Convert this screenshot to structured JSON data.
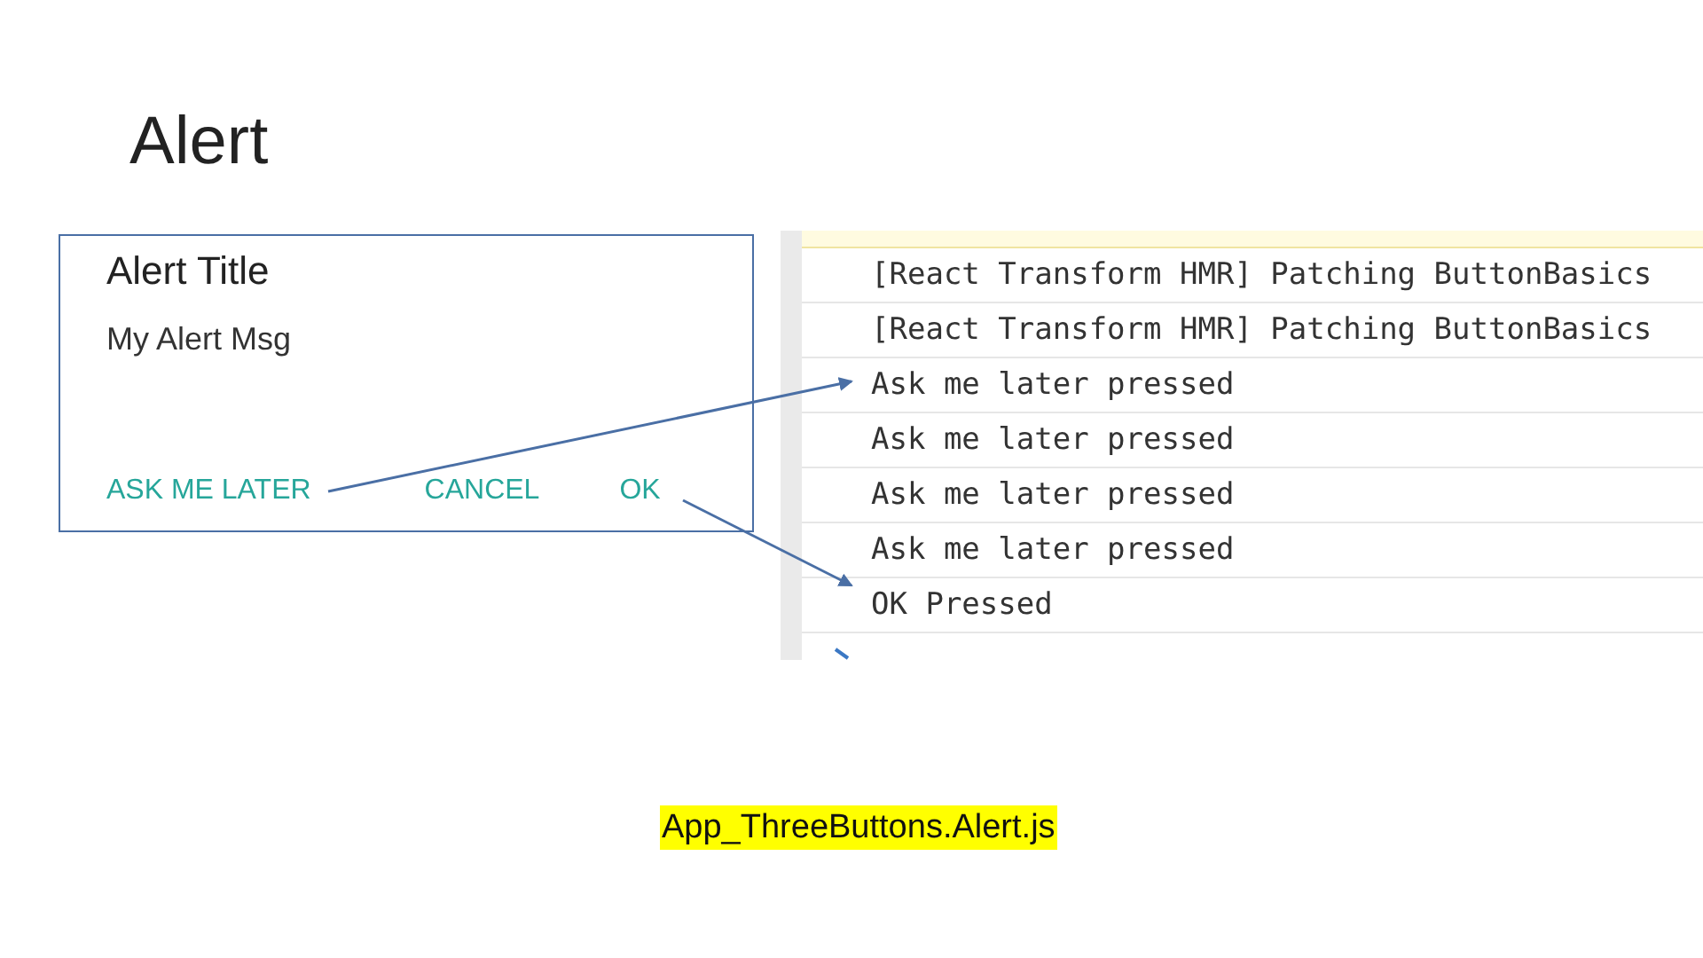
{
  "slide_title": "Alert",
  "dialog": {
    "title": "Alert Title",
    "message": "My Alert Msg",
    "buttons": [
      "ASK ME LATER",
      "CANCEL",
      "OK"
    ]
  },
  "console": {
    "lines": [
      "[React Transform HMR] Patching ButtonBasics",
      "[React Transform HMR] Patching ButtonBasics",
      "Ask me later pressed",
      "Ask me later pressed",
      "Ask me later pressed",
      "Ask me later pressed",
      "OK Pressed"
    ]
  },
  "caption": "App_ThreeButtons.Alert.js"
}
